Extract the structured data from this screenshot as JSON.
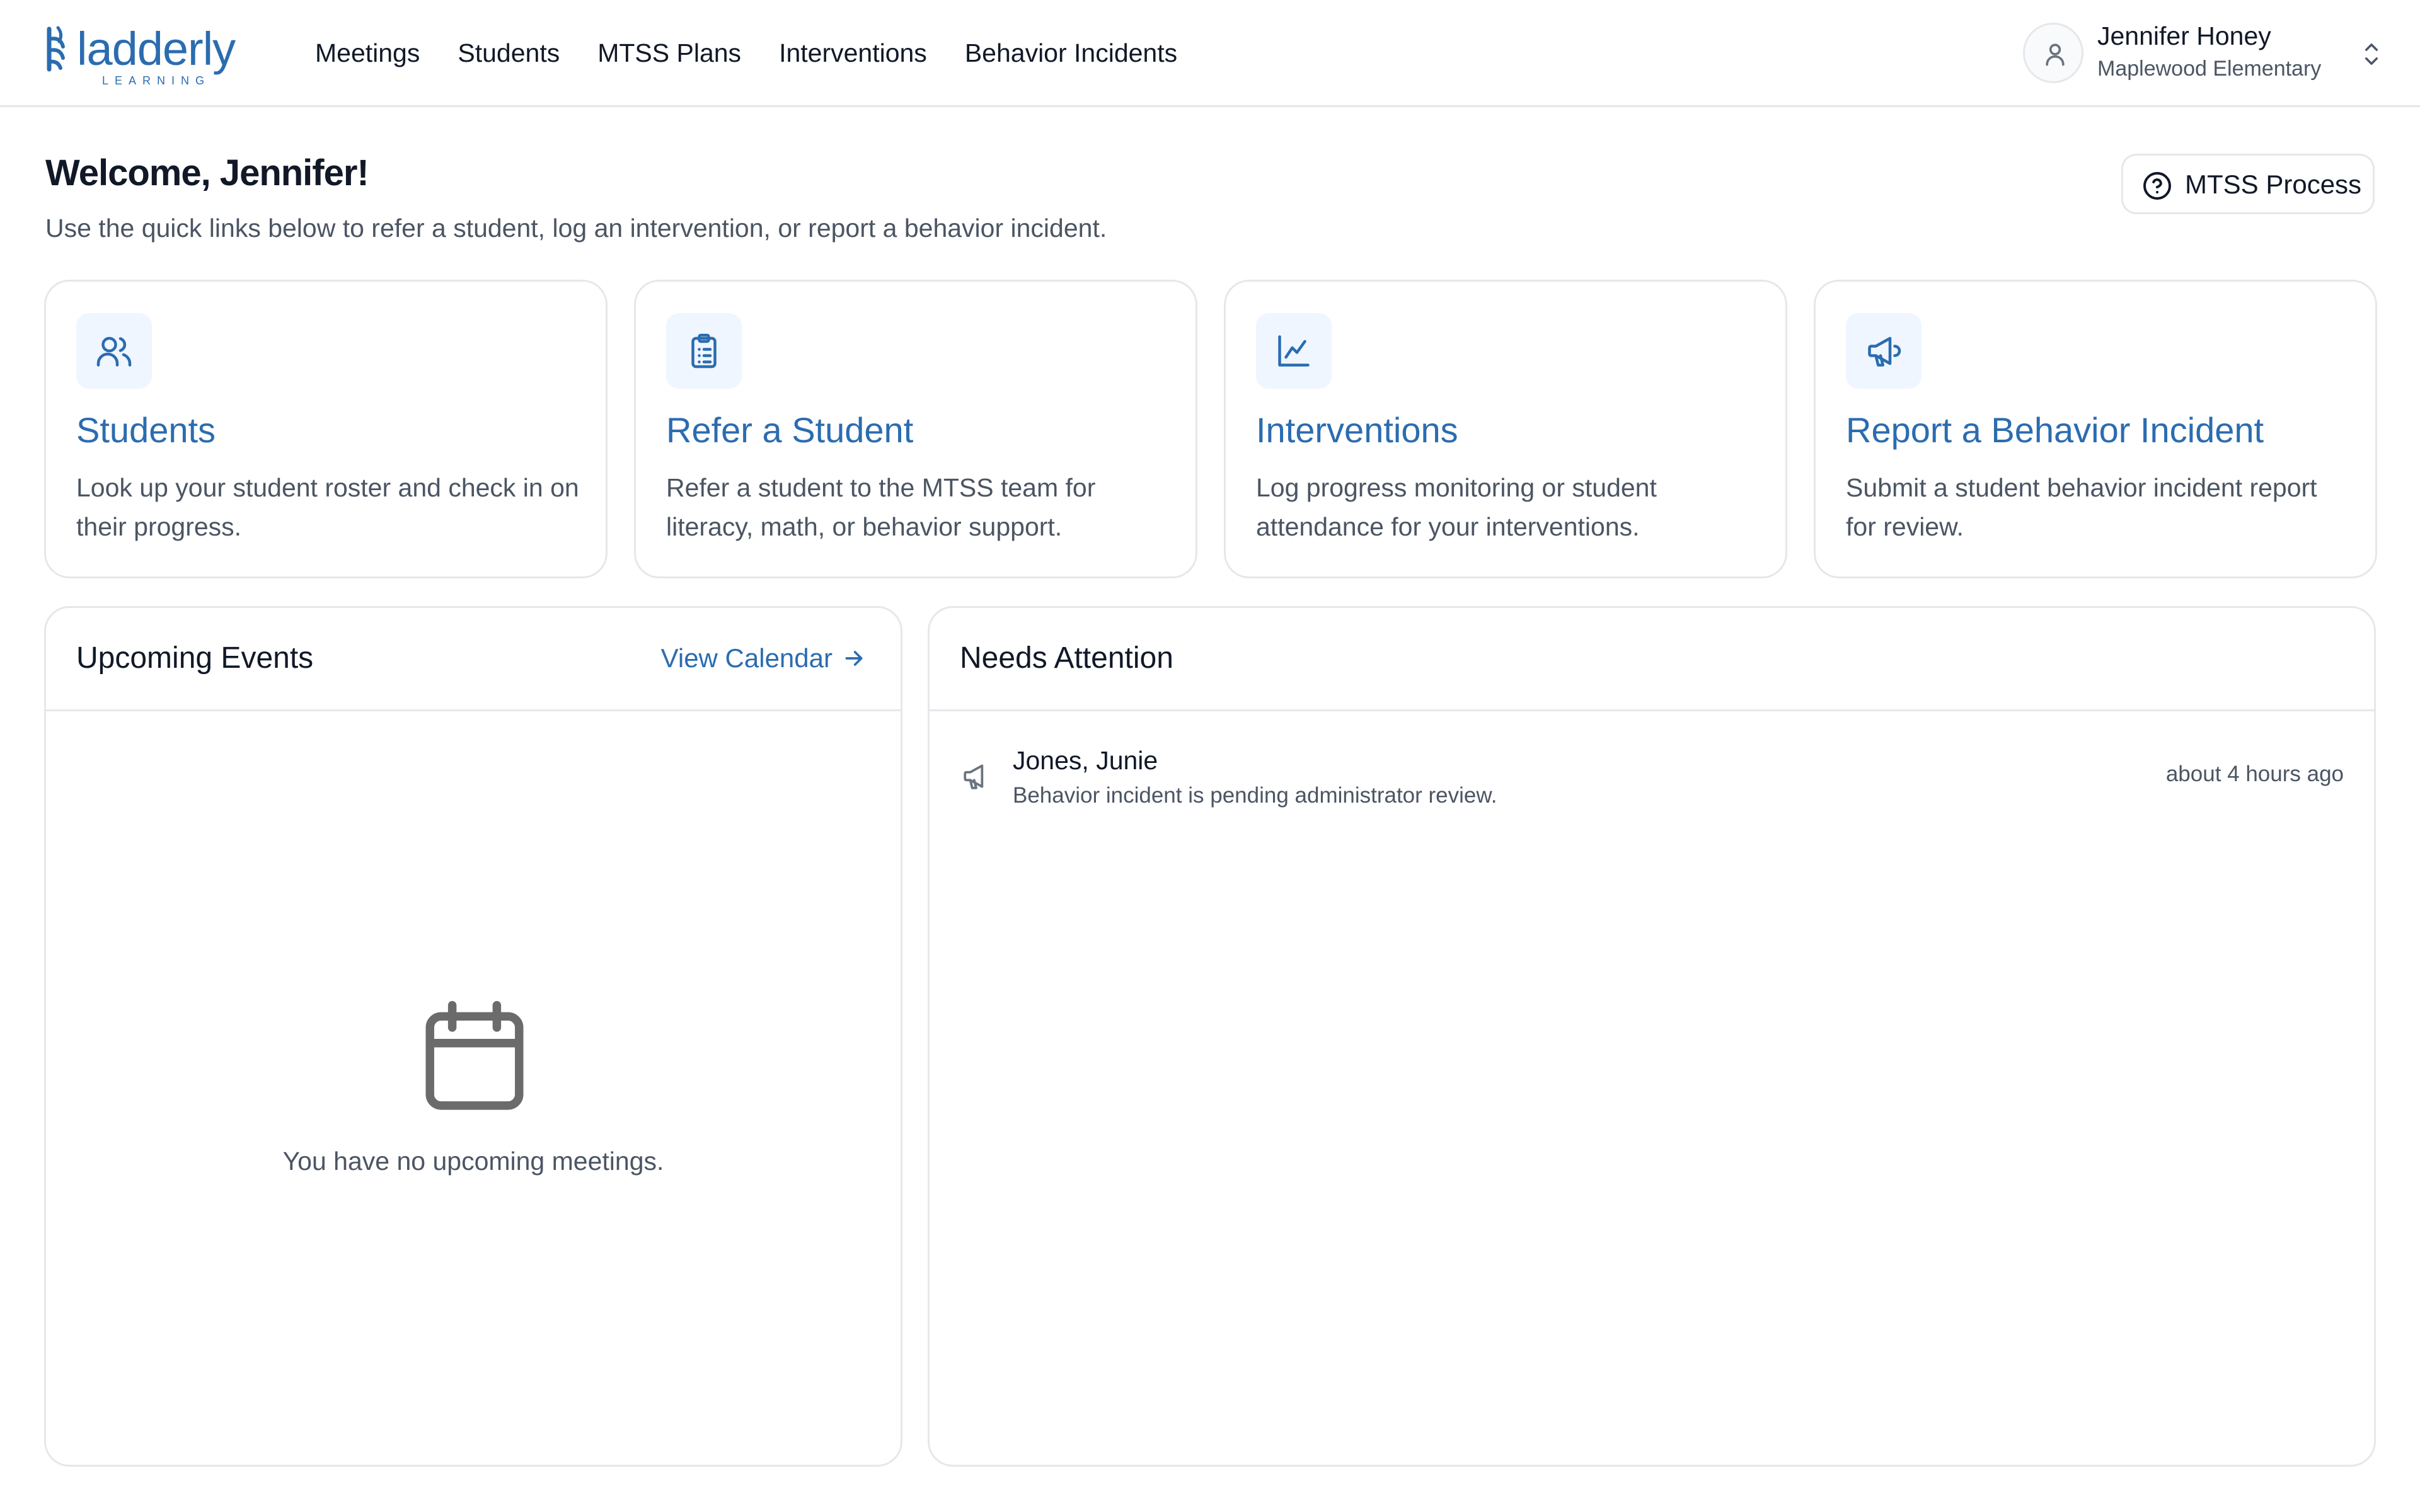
{
  "brand": {
    "name": "ladderly",
    "tagline": "LEARNING",
    "color": "#2b6cb0"
  },
  "nav": {
    "items": [
      {
        "label": "Meetings"
      },
      {
        "label": "Students"
      },
      {
        "label": "MTSS Plans"
      },
      {
        "label": "Interventions"
      },
      {
        "label": "Behavior Incidents"
      }
    ]
  },
  "user": {
    "name": "Jennifer Honey",
    "school": "Maplewood Elementary",
    "avatar_icon": "user-icon",
    "switcher_icon": "chevron-up-down-icon"
  },
  "welcome": {
    "title": "Welcome, Jennifer!",
    "subtitle": "Use the quick links below to refer a student, log an intervention, or report a behavior incident."
  },
  "help_button": {
    "label": "MTSS Process",
    "icon": "help-circle-icon"
  },
  "quick_links": [
    {
      "title": "Students",
      "description": "Look up your student roster and check in on their progress.",
      "icon": "users-icon"
    },
    {
      "title": "Refer a Student",
      "description": "Refer a student to the MTSS team for literacy, math, or behavior support.",
      "icon": "clipboard-list-icon"
    },
    {
      "title": "Interventions",
      "description": "Log progress monitoring or student attendance for your interventions.",
      "icon": "line-chart-icon"
    },
    {
      "title": "Report a Behavior Incident",
      "description": "Submit a student behavior incident report for review.",
      "icon": "megaphone-icon"
    }
  ],
  "upcoming_events": {
    "title": "Upcoming Events",
    "link_label": "View Calendar",
    "link_icon": "arrow-right-icon",
    "empty_icon": "calendar-icon",
    "empty_message": "You have no upcoming meetings."
  },
  "needs_attention": {
    "title": "Needs Attention",
    "items": [
      {
        "name": "Jones, Junie",
        "message": "Behavior incident is pending administrator review.",
        "time": "about 4 hours ago",
        "icon": "megaphone-icon"
      }
    ]
  }
}
